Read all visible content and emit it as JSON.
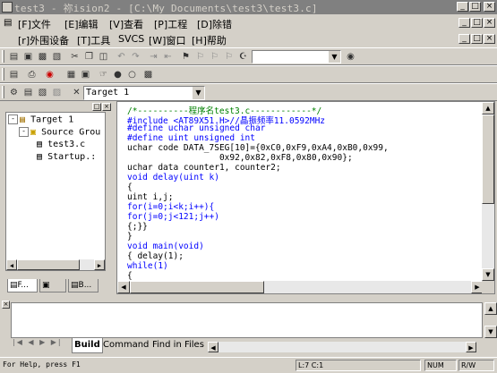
{
  "title": "test3  - 祢ision2 - [C:\\My Documents\\test3\\test3.c]",
  "window_buttons": {
    "minimize": "_",
    "maximize": "□",
    "close": "×"
  },
  "menu_row1": [
    "[F]文件",
    "[E]编辑",
    "[V]查看",
    "[P]工程",
    "[D]除错"
  ],
  "menu_row2": [
    "[r]外围设备",
    "[T]工具",
    "SVCS",
    "[W]窗口",
    "[H]帮助"
  ],
  "target_select": "Target 1",
  "find_combo": "",
  "tree": {
    "root": "Target 1",
    "group": "Source Grou",
    "files": [
      "test3.c",
      "Startup.:"
    ]
  },
  "panel_tabs": [
    "F...",
    "",
    "B..."
  ],
  "code_lines": [
    {
      "t": "/*----------程序名test3.c------------*/",
      "c": "cm"
    },
    {
      "t": "#include <AT89X51.H>//晶振频率11.0592MHz",
      "c": "kw"
    },
    {
      "t": "#define uchar unsigned char",
      "c": "kw"
    },
    {
      "t": "#define uint unsigned int",
      "c": "kw"
    },
    {
      "t": "uchar code DATA_7SEG[10]={0xC0,0xF9,0xA4,0xB0,0x99,",
      "c": ""
    },
    {
      "t": "                  0x92,0x82,0xF8,0x80,0x90};",
      "c": ""
    },
    {
      "t": "uchar data counter1, counter2;",
      "c": ""
    },
    {
      "t": "void delay(uint k)",
      "c": "kw"
    },
    {
      "t": "{",
      "c": ""
    },
    {
      "t": "uint i,j;",
      "c": ""
    },
    {
      "t": "for(i=0;i<k;i++){",
      "c": "kw"
    },
    {
      "t": "for(j=0;j<121;j++)",
      "c": "kw"
    },
    {
      "t": "{;}}",
      "c": ""
    },
    {
      "t": "}",
      "c": ""
    },
    {
      "t": "void main(void)",
      "c": "kw"
    },
    {
      "t": "{ delay(1);",
      "c": ""
    },
    {
      "t": "while(1)",
      "c": "kw"
    },
    {
      "t": "{",
      "c": ""
    }
  ],
  "output_tabs": [
    "Build",
    "Command",
    "Find in Files"
  ],
  "status": {
    "help": "For Help, press F1",
    "position": "L:7 C:1",
    "mode1": "NUM",
    "mode2": "R/W"
  }
}
